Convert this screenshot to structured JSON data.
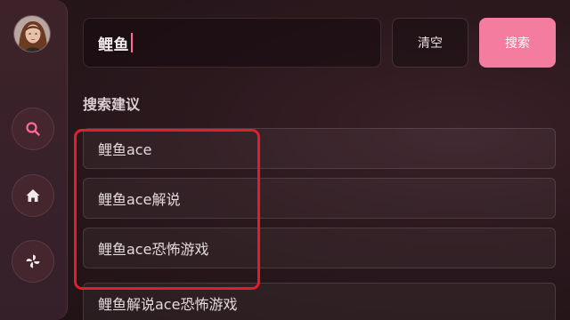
{
  "search": {
    "query": "鲤鱼",
    "clear_label": "清空",
    "submit_label": "搜索"
  },
  "sidebar": {
    "items": [
      {
        "name": "search",
        "icon": "search-icon",
        "active": true
      },
      {
        "name": "home",
        "icon": "home-icon"
      },
      {
        "name": "pinwheel",
        "icon": "pinwheel-icon"
      }
    ]
  },
  "suggestions": {
    "title": "搜索建议",
    "items": [
      "鲤鱼ace",
      "鲤鱼ace解说",
      "鲤鱼ace恐怖游戏",
      "鲤鱼解说ace恐怖游戏"
    ]
  },
  "colors": {
    "accent": "#f47c9e",
    "highlight": "#e01e2e",
    "background": "#2a181d"
  }
}
